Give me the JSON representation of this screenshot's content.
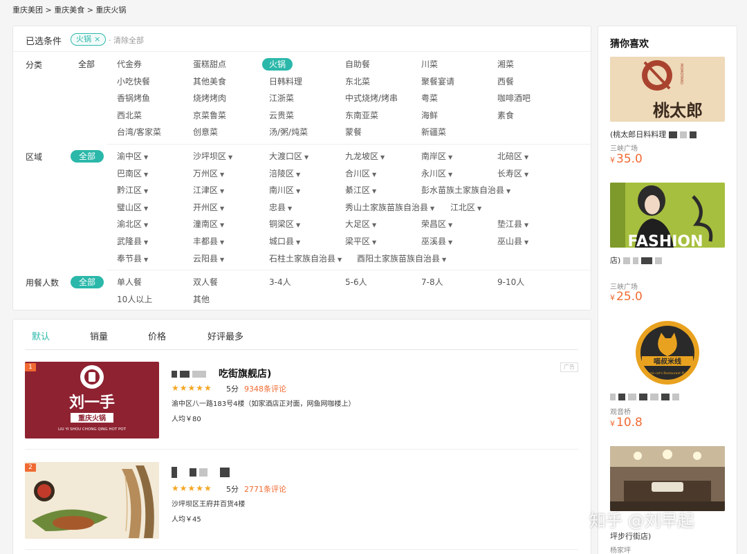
{
  "breadcrumb": "重庆美团 > 重庆美食 > 重庆火锅",
  "filter": {
    "selected_label": "已选条件",
    "selected_tag": "火锅",
    "clear_all": "· 清除全部",
    "category_label": "分类",
    "category_all": "全部",
    "categories": [
      "代金券",
      "蛋糕甜点",
      "火锅",
      "自助餐",
      "川菜",
      "湘菜",
      "小吃快餐",
      "其他美食",
      "日韩料理",
      "东北菜",
      "聚餐宴请",
      "西餐",
      "香锅烤鱼",
      "烧烤烤肉",
      "江浙菜",
      "中式烧烤/烤串",
      "粤菜",
      "咖啡酒吧",
      "西北菜",
      "京菜鲁菜",
      "云贵菜",
      "东南亚菜",
      "海鲜",
      "素食",
      "台湾/客家菜",
      "创意菜",
      "汤/粥/炖菜",
      "蒙餐",
      "新疆菜"
    ],
    "area_label": "区域",
    "area_all": "全部",
    "areas": [
      "渝中区",
      "沙坪坝区",
      "大渡口区",
      "九龙坡区",
      "南岸区",
      "北碚区",
      "巴南区",
      "万州区",
      "涪陵区",
      "合川区",
      "永川区",
      "长寿区",
      "黔江区",
      "江津区",
      "南川区",
      "綦江区",
      "彭水苗族土家族自治县",
      "璧山区",
      "开州区",
      "忠县",
      "秀山土家族苗族自治县",
      "江北区",
      "渝北区",
      "潼南区",
      "铜梁区",
      "大足区",
      "荣昌区",
      "垫江县",
      "武隆县",
      "丰都县",
      "城口县",
      "梁平区",
      "巫溪县",
      "巫山县",
      "奉节县",
      "云阳县",
      "石柱土家族自治县",
      "酉阳土家族苗族自治县"
    ],
    "people_label": "用餐人数",
    "people_all": "全部",
    "people": [
      "单人餐",
      "双人餐",
      "3-4人",
      "5-6人",
      "7-8人",
      "9-10人",
      "10人以上",
      "其他"
    ]
  },
  "sort_tabs": [
    "默认",
    "销量",
    "价格",
    "好评最多"
  ],
  "results": [
    {
      "rank": "1",
      "name_visible": "吃街旗舰店)",
      "stars": "★★★★★",
      "score": "5分",
      "reviews": "9348条评论",
      "address": "渝中区八一路183号4楼（如家酒店正对面，网鱼网咖楼上）",
      "price": "人均￥80",
      "ad": "广告",
      "logo_title": "刘一手",
      "logo_sub": "重庆火锅",
      "logo_en": "LIU YI SHOU CHONG QING HOT POT"
    },
    {
      "rank": "2",
      "name_visible": "",
      "stars": "★★★★★",
      "score": "5分",
      "reviews": "2771条评论",
      "address": "沙坪坝区王府井百货4楼",
      "price": "人均￥45"
    }
  ],
  "sidebar": {
    "title": "猜你喜欢",
    "items": [
      {
        "name": "(桃太郎日料料理",
        "area": "三峡广场",
        "currency": "¥",
        "price": "35.0",
        "img_text": "桃太郎",
        "img_small": "MOMOTARO"
      },
      {
        "name": "店)",
        "area": "三峡广场",
        "currency": "¥",
        "price": "25.0",
        "img_text": "FASHION"
      },
      {
        "name": "",
        "area": "观音桥",
        "currency": "¥",
        "price": "10.8",
        "img_text": "喵叔米线",
        "img_small": "Uncle cat's Restaurant PLUS"
      },
      {
        "name": "坪步行街店)",
        "area": "杨家坪",
        "currency": "",
        "price": ""
      }
    ]
  },
  "watermark": "知乎 @刘早起"
}
